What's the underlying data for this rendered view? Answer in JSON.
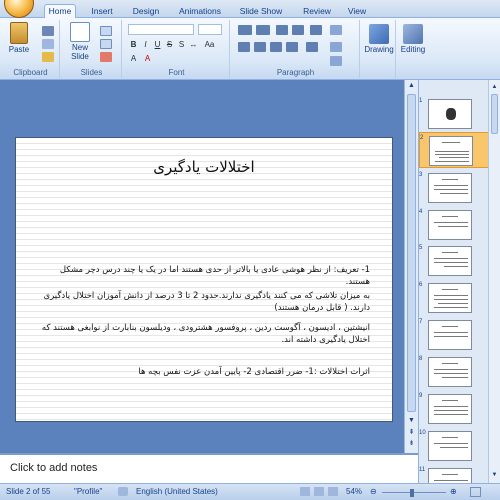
{
  "ribbon": {
    "tabs": [
      "Home",
      "Insert",
      "Design",
      "Animations",
      "Slide Show",
      "Review",
      "View"
    ],
    "clipboard": {
      "paste": "Paste",
      "label": "Clipboard"
    },
    "slides": {
      "new_slide": "New",
      "new_slide_2": "Slide",
      "label": "Slides"
    },
    "font": {
      "label": "Font"
    },
    "paragraph": {
      "label": "Paragraph"
    },
    "drawing": {
      "label": "Drawing"
    },
    "editing": {
      "label": "Editing"
    }
  },
  "slide": {
    "title": "اختلالات یادگیری",
    "paragraphs": [
      "1- تعریف: از نظر هوشی عادی یا بالاتر از حدی هستند اما در یک یا چند درس دچر مشکل هستند.",
      "به میزان تلاشی که می کنند یادگیری ندارند.حدود 2 تا 3 درصد از دانش آموزان اختلال یادگیری دارند. ( قابل درمان هستند)",
      "انیشتین ، ادیسون ، آگوست ردین ، پروفسور هشترودی ، ودیلسون بنابارت از نوابغی هستند که اختلال یادگیری داشته اند.",
      "اثرات اختلالات :1- ضرر اقتصادی   2- پایین آمدن عزت نفس بچه ها"
    ]
  },
  "notes": {
    "placeholder": "Click to add notes"
  },
  "thumbnails": {
    "numbers": [
      "1",
      "2",
      "3",
      "4",
      "5",
      "6",
      "7",
      "8",
      "9",
      "10",
      "11"
    ],
    "selected": "2"
  },
  "status": {
    "slide_info": "Slide 2 of 55",
    "theme": "\"Profile\"",
    "language": "English (United States)",
    "zoom": "54%"
  },
  "colors": {
    "ribbon_text": "#15428b",
    "workspace": "#5b82bd",
    "selected_thumb": "#f9c66b"
  }
}
